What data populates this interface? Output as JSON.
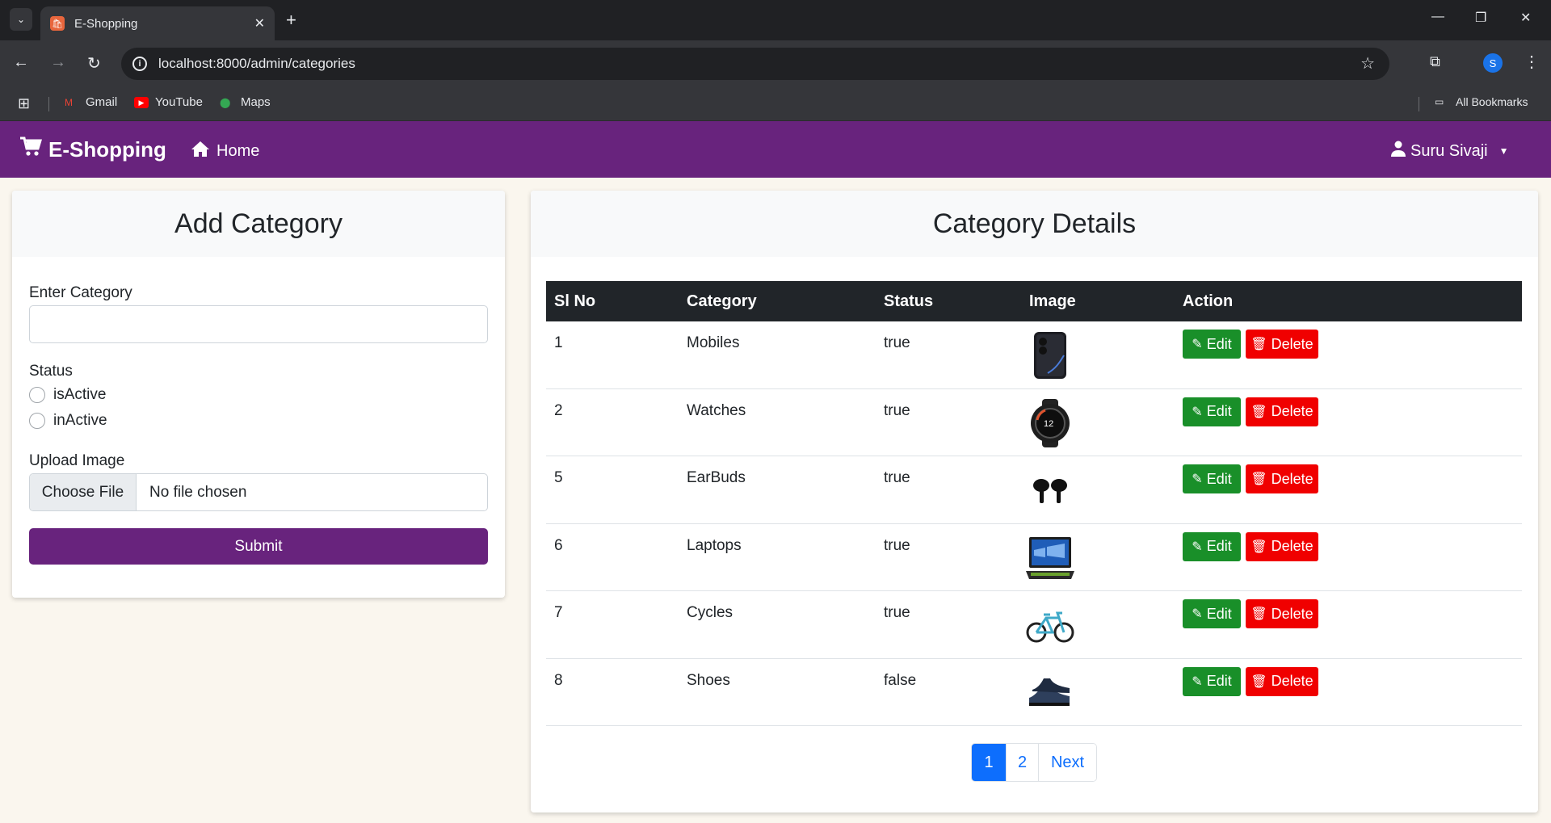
{
  "browser": {
    "tab_title": "E-Shopping",
    "url": "localhost:8000/admin/categories",
    "profile_initial": "S",
    "bookmarks": [
      {
        "label": "Gmail",
        "icon": "gmail-icon"
      },
      {
        "label": "YouTube",
        "icon": "youtube-icon"
      },
      {
        "label": "Maps",
        "icon": "maps-icon"
      }
    ],
    "all_bookmarks": "All Bookmarks"
  },
  "navbar": {
    "brand": "E-Shopping",
    "home": "Home",
    "user": "Suru Sivaji",
    "color": "#68237d"
  },
  "add_category": {
    "title": "Add Category",
    "category_label": "Enter Category",
    "category_value": "",
    "status_label": "Status",
    "status_options": [
      "isActive",
      "inActive"
    ],
    "upload_label": "Upload Image",
    "file_button": "Choose File",
    "file_name": "No file chosen",
    "submit": "Submit"
  },
  "category_details": {
    "title": "Category Details",
    "columns": [
      "Sl No",
      "Category",
      "Status",
      "Image",
      "Action"
    ],
    "rows": [
      {
        "sl": "1",
        "category": "Mobiles",
        "status": "true",
        "image": "mobile-image"
      },
      {
        "sl": "2",
        "category": "Watches",
        "status": "true",
        "image": "watch-image"
      },
      {
        "sl": "5",
        "category": "EarBuds",
        "status": "true",
        "image": "earbuds-image"
      },
      {
        "sl": "6",
        "category": "Laptops",
        "status": "true",
        "image": "laptop-image"
      },
      {
        "sl": "7",
        "category": "Cycles",
        "status": "true",
        "image": "cycle-image"
      },
      {
        "sl": "8",
        "category": "Shoes",
        "status": "false",
        "image": "shoes-image"
      }
    ],
    "edit_label": "Edit",
    "delete_label": "Delete",
    "edit_color": "#198f29",
    "delete_color": "#f00000"
  },
  "pagination": {
    "pages": [
      "1",
      "2"
    ],
    "active_page": "1",
    "next": "Next"
  }
}
